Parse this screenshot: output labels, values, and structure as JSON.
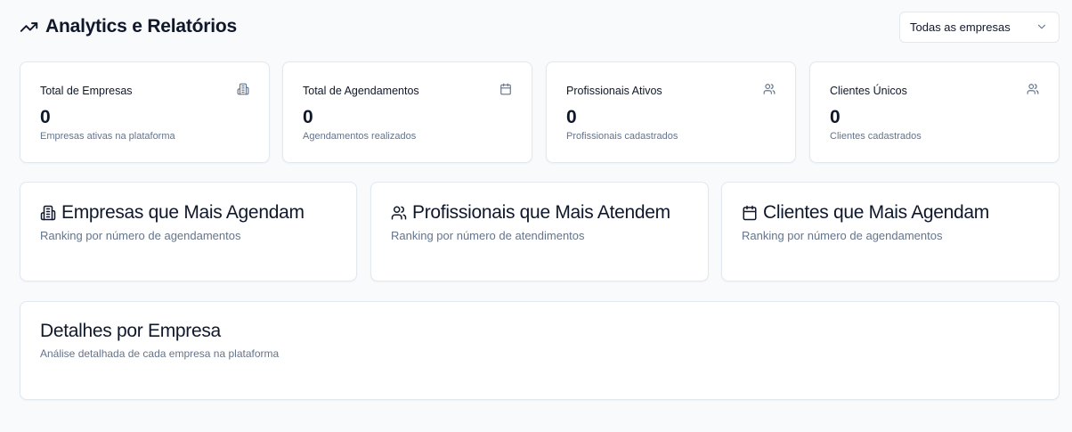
{
  "header": {
    "title": "Analytics e Relatórios",
    "title_icon": "trending-up-icon",
    "company_select": {
      "value": "Todas as empresas"
    }
  },
  "stats": [
    {
      "label": "Total de Empresas",
      "value": "0",
      "description": "Empresas ativas na plataforma",
      "icon": "building-icon"
    },
    {
      "label": "Total de Agendamentos",
      "value": "0",
      "description": "Agendamentos realizados",
      "icon": "calendar-icon"
    },
    {
      "label": "Profissionais Ativos",
      "value": "0",
      "description": "Profissionais cadastrados",
      "icon": "users-icon"
    },
    {
      "label": "Clientes Únicos",
      "value": "0",
      "description": "Clientes cadastrados",
      "icon": "users-icon"
    }
  ],
  "rankings": [
    {
      "title": "Empresas que Mais Agendam",
      "description": "Ranking por número de agendamentos",
      "icon": "building-icon"
    },
    {
      "title": "Profissionais que Mais Atendem",
      "description": "Ranking por número de atendimentos",
      "icon": "users-icon"
    },
    {
      "title": "Clientes que Mais Agendam",
      "description": "Ranking por número de agendamentos",
      "icon": "calendar-icon"
    }
  ],
  "details": {
    "title": "Detalhes por Empresa",
    "description": "Análise detalhada de cada empresa na plataforma"
  },
  "colors": {
    "background": "#f8fafc",
    "card": "#ffffff",
    "border": "#e2e8f0",
    "text": "#0f172a",
    "muted": "#64748b"
  }
}
